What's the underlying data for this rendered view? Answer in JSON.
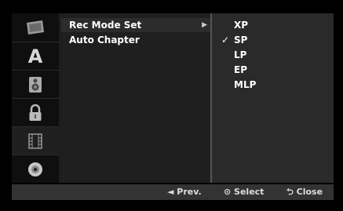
{
  "menu": {
    "items": [
      {
        "label": "Rec Mode Set",
        "selected": true,
        "has_submenu": true
      },
      {
        "label": "Auto Chapter",
        "selected": false,
        "has_submenu": false
      }
    ]
  },
  "options": {
    "items": [
      {
        "label": "XP",
        "checked": false
      },
      {
        "label": "SP",
        "checked": true
      },
      {
        "label": "LP",
        "checked": false
      },
      {
        "label": "EP",
        "checked": false
      },
      {
        "label": "MLP",
        "checked": false
      }
    ],
    "check_glyph": "✓"
  },
  "sidebar": {
    "icons": [
      {
        "name": "display-icon"
      },
      {
        "name": "language-icon",
        "glyph": "A"
      },
      {
        "name": "audio-speaker-icon"
      },
      {
        "name": "lock-icon"
      },
      {
        "name": "film-record-icon",
        "active": true
      },
      {
        "name": "disc-icon"
      }
    ]
  },
  "footer": {
    "prev_label": "◄ Prev.",
    "select_label": "⊙ Select",
    "close_label": "⮌ Close"
  },
  "colors": {
    "background": "#000000",
    "panel": "#1e1e1e",
    "icon_column": "#0f0f0f",
    "options_panel": "#2a2a2a",
    "footer_bar": "#333333",
    "text": "#ffffff"
  }
}
